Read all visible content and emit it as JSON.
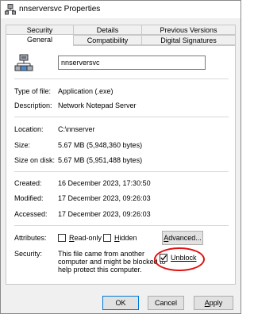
{
  "window": {
    "title": "nnserversvc Properties"
  },
  "tabs": {
    "row1": [
      "Security",
      "Details",
      "Previous Versions"
    ],
    "row2": [
      "General",
      "Compatibility",
      "Digital Signatures"
    ],
    "active": "General"
  },
  "general": {
    "file_name": "nnserversvc",
    "type_label": "Type of file:",
    "type_value": "Application (.exe)",
    "description_label": "Description:",
    "description_value": "Network Notepad Server",
    "location_label": "Location:",
    "location_value": "C:\\nnserver",
    "size_label": "Size:",
    "size_value": "5.67 MB (5,948,360 bytes)",
    "size_on_disk_label": "Size on disk:",
    "size_on_disk_value": "5.67 MB (5,951,488 bytes)",
    "created_label": "Created:",
    "created_value": "16 December 2023, 17:30:50",
    "modified_label": "Modified:",
    "modified_value": "17 December 2023, 09:26:03",
    "accessed_label": "Accessed:",
    "accessed_value": "17 December 2023, 09:26:03",
    "attributes_label": "Attributes:",
    "readonly_first": "R",
    "readonly_rest": "ead-only",
    "readonly_checked": false,
    "hidden_first": "H",
    "hidden_rest": "idden",
    "hidden_checked": false,
    "advanced_first": "A",
    "advanced_rest": "dvanced...",
    "security_label": "Security:",
    "security_line1": "This file came from another",
    "security_line2": "computer and might be blocked to",
    "security_line3": "help protect this computer.",
    "unblock_label": "Unblock",
    "unblock_checked": true
  },
  "buttons": {
    "ok": "OK",
    "cancel": "Cancel",
    "apply_first": "A",
    "apply_rest": "pply"
  },
  "colors": {
    "highlight_circle": "#e01010",
    "accent_border": "#0078d7"
  }
}
